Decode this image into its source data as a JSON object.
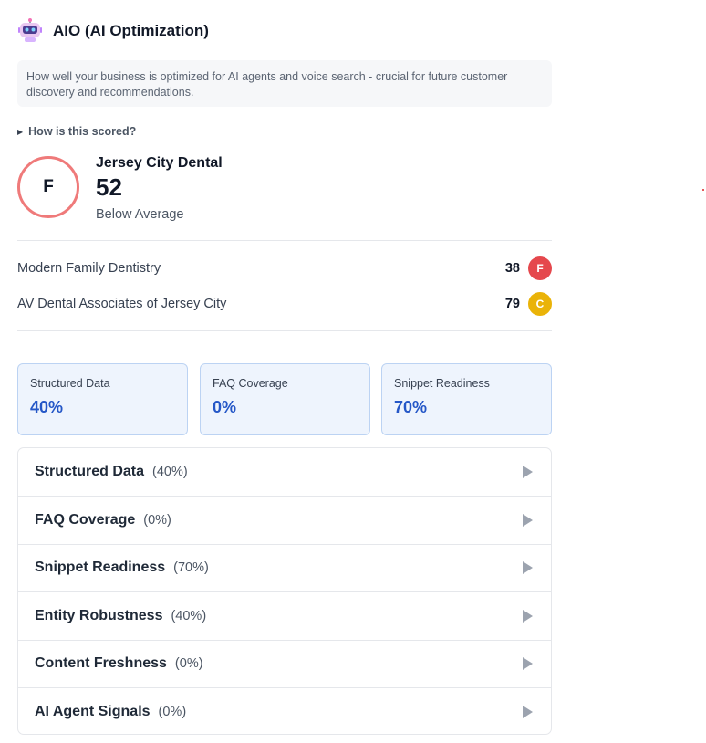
{
  "header": {
    "title": "AIO (AI Optimization)",
    "icon": "robot-icon"
  },
  "description": "How well your business is optimized for AI agents and voice search - crucial for future customer discovery and recommendations.",
  "how_scored": {
    "label": "How is this scored?",
    "icon": "triangle-right-icon"
  },
  "business": {
    "name": "Jersey City Dental",
    "score": "52",
    "grade": "F",
    "rating": "Below Average",
    "ring_color": "#ef7a7a"
  },
  "competitors": [
    {
      "name": "Modern Family Dentistry",
      "score": "38",
      "grade": "F",
      "color": "#e5484d"
    },
    {
      "name": "AV Dental Associates of Jersey City",
      "score": "79",
      "grade": "C",
      "color": "#eab308"
    }
  ],
  "metric_cards": [
    {
      "label": "Structured Data",
      "value": "40%"
    },
    {
      "label": "FAQ Coverage",
      "value": "0%"
    },
    {
      "label": "Snippet Readiness",
      "value": "70%"
    }
  ],
  "sections": [
    {
      "title": "Structured Data",
      "percent": "(40%)"
    },
    {
      "title": "FAQ Coverage",
      "percent": "(0%)"
    },
    {
      "title": "Snippet Readiness",
      "percent": "(70%)"
    },
    {
      "title": "Entity Robustness",
      "percent": "(40%)"
    },
    {
      "title": "Content Freshness",
      "percent": "(0%)"
    },
    {
      "title": "AI Agent Signals",
      "percent": "(0%)"
    }
  ],
  "colors": {
    "accent": "#2557c7",
    "card_bg": "#eef4fd",
    "card_border": "#bcd3f3"
  }
}
